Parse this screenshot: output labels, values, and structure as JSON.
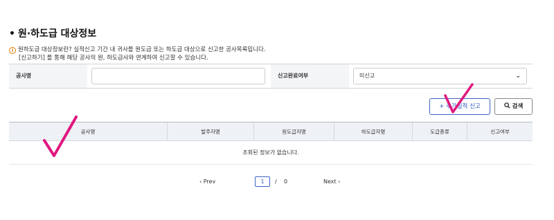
{
  "section": {
    "bullet": "•",
    "title": "원·하도급 대상정보"
  },
  "notice": {
    "icon_glyph": "i",
    "line1": "원하도급 대상정보란? 실적신고 기간 내 귀사를 원도급 또는 하도급 대상으로 신고한 공사목록입니다.",
    "line2": "[신고하기] 를 통해 해당 공사의 원, 하도급사와 연계하여 신고할 수 있습니다."
  },
  "search": {
    "name_label": "공사명",
    "name_value": "",
    "name_placeholder": "",
    "status_label": "신고완료여부",
    "status_value": "미신고",
    "status_chevron": "⌄"
  },
  "buttons": {
    "add_label": "+ 추가실적 신고",
    "search_label": "검색",
    "search_icon": "🔍"
  },
  "table": {
    "columns": [
      "공사명",
      "발주자명",
      "원도급자명",
      "하도급자명",
      "도급종류",
      "신고여부"
    ],
    "empty_message": "조회된 정보가 없습니다."
  },
  "pager": {
    "prev_label": "‹ Prev",
    "current_page": "1",
    "separator": "/",
    "total_pages": "0",
    "next_label": "Next ›"
  },
  "annotation_color": "#e0177f"
}
